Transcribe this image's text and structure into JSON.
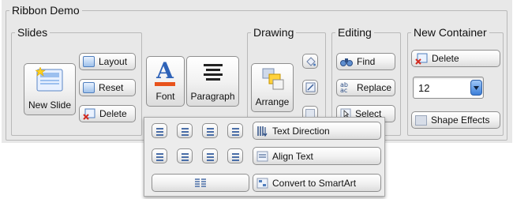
{
  "ribbon": {
    "title": "Ribbon Demo"
  },
  "slides": {
    "title": "Slides",
    "new_slide_label": "New Slide",
    "layout_label": "Layout",
    "reset_label": "Reset",
    "delete_label": "Delete"
  },
  "font_group": {
    "font_label": "Font",
    "paragraph_label": "Paragraph",
    "font_letter": "A"
  },
  "drawing": {
    "title": "Drawing",
    "arrange_label": "Arrange"
  },
  "editing": {
    "title": "Editing",
    "find_label": "Find",
    "replace_label": "Replace",
    "select_label": "Select"
  },
  "new_container": {
    "title": "New Container",
    "delete_label": "Delete",
    "spinner_value": "12",
    "shape_effects_label": "Shape Effects"
  },
  "paragraph_popup": {
    "text_direction_label": "Text Direction",
    "align_text_label": "Align Text",
    "convert_label": "Convert to SmartArt"
  },
  "colors": {
    "accent_blue": "#4f7ebd",
    "font_underline": "#e8531c",
    "panel_bg": "#e8e8e8"
  }
}
